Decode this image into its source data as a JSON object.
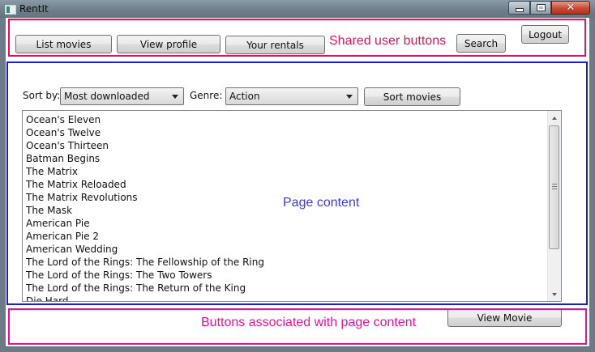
{
  "window": {
    "title": "RentIt"
  },
  "header": {
    "list_movies": "List movies",
    "view_profile": "View profile",
    "your_rentals": "Your rentals",
    "search": "Search",
    "logout": "Logout"
  },
  "annotations": {
    "top": "Shared user buttons",
    "middle": "Page content",
    "bottom": "Buttons associated with page content"
  },
  "filters": {
    "sort_label": "Sort by:",
    "sort_value": "Most downloaded",
    "genre_label": "Genre:",
    "genre_value": "Action",
    "sort_button": "Sort movies"
  },
  "movies": [
    "Ocean's Eleven",
    "Ocean's Twelve",
    "Ocean's Thirteen",
    "Batman Begins",
    "The Matrix",
    "The Matrix Reloaded",
    "The Matrix Revolutions",
    "The Mask",
    "American Pie",
    "American Pie 2",
    "American Wedding",
    "The Lord of the Rings: The Fellowship of the Ring",
    "The Lord of the Rings: The Two Towers",
    "The Lord of the Rings: The Return of the King",
    "Die Hard"
  ],
  "footer": {
    "view_movie": "View Movie"
  }
}
